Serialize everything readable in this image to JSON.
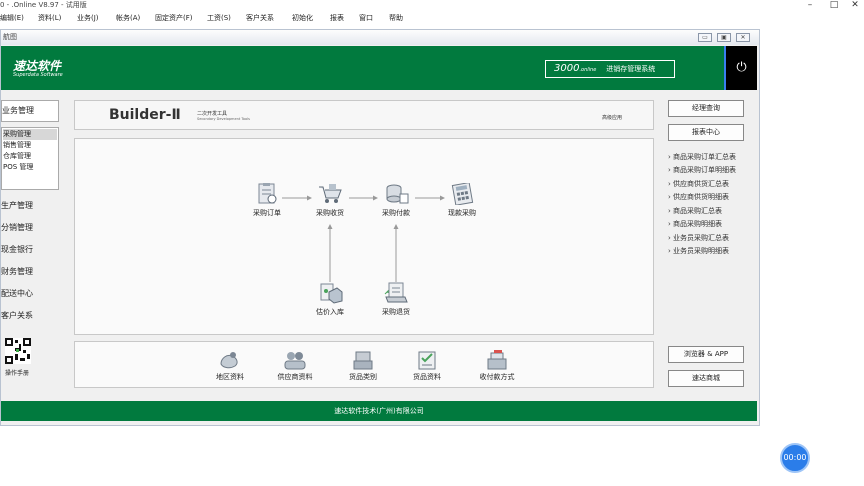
{
  "app": {
    "title": "0 - .Online V8.97 - 试用版"
  },
  "menu": [
    "编辑(E)",
    "资料(L)",
    "业务(J)",
    "帐务(A)",
    "固定资产(F)",
    "工资(S)",
    "客户关系",
    "初始化",
    "报表",
    "窗口",
    "帮助"
  ],
  "inner_window": {
    "title": "航图"
  },
  "banner": {
    "logo_cn": "速达软件",
    "logo_en": "Superdata Software",
    "product_num": "3000",
    "product_suffix": ".online",
    "product_name": "进销存管理系统",
    "power_icon": "power-icon",
    "brand_color": "#017a3e"
  },
  "sidebar": {
    "header": "业务管理",
    "subitems": [
      "采购管理",
      "销售管理",
      "仓库管理",
      "POS 管理"
    ],
    "categories": [
      "生产管理",
      "分销管理",
      "现金银行",
      "财务管理",
      "配送中心",
      "客户关系"
    ],
    "qr_label": "操作手册"
  },
  "builder": {
    "title": "Builder-Ⅱ",
    "sub_cn": "二次开发工具",
    "sub_en": "Secondary Development Tools",
    "advanced": "高级应用"
  },
  "flow": {
    "nodes": [
      {
        "id": "purchase-order",
        "label": "采购订单",
        "icon": "order-clipboard-icon"
      },
      {
        "id": "purchase-receive",
        "label": "采购收货",
        "icon": "cart-icon"
      },
      {
        "id": "purchase-payment",
        "label": "采购付款",
        "icon": "coins-icon"
      },
      {
        "id": "cash-purchase",
        "label": "现款采购",
        "icon": "calculator-icon"
      },
      {
        "id": "valuation-inbound",
        "label": "估价入库",
        "icon": "package-icon"
      },
      {
        "id": "purchase-return",
        "label": "采购退货",
        "icon": "return-document-icon"
      }
    ]
  },
  "basic": {
    "items": [
      {
        "label": "地区资料",
        "icon": "map-icon"
      },
      {
        "label": "供应商资料",
        "icon": "people-icon"
      },
      {
        "label": "货品类别",
        "icon": "box-stack-icon"
      },
      {
        "label": "货品资料",
        "icon": "checklist-icon"
      },
      {
        "label": "收付款方式",
        "icon": "cash-register-icon"
      }
    ]
  },
  "right": {
    "top_buttons": [
      "经理查询",
      "报表中心"
    ],
    "links": [
      "商品采购订单汇总表",
      "商品采购订单明细表",
      "供应商供货汇总表",
      "供应商供货明细表",
      "商品采购汇总表",
      "商品采购明细表",
      "业务员采购汇总表",
      "业务员采购明细表"
    ],
    "bottom_buttons": [
      "浏览器 & APP",
      "速达商城"
    ]
  },
  "footer": {
    "text": "速达软件技术(广州)有限公司"
  },
  "timer": {
    "text": "00:00"
  }
}
